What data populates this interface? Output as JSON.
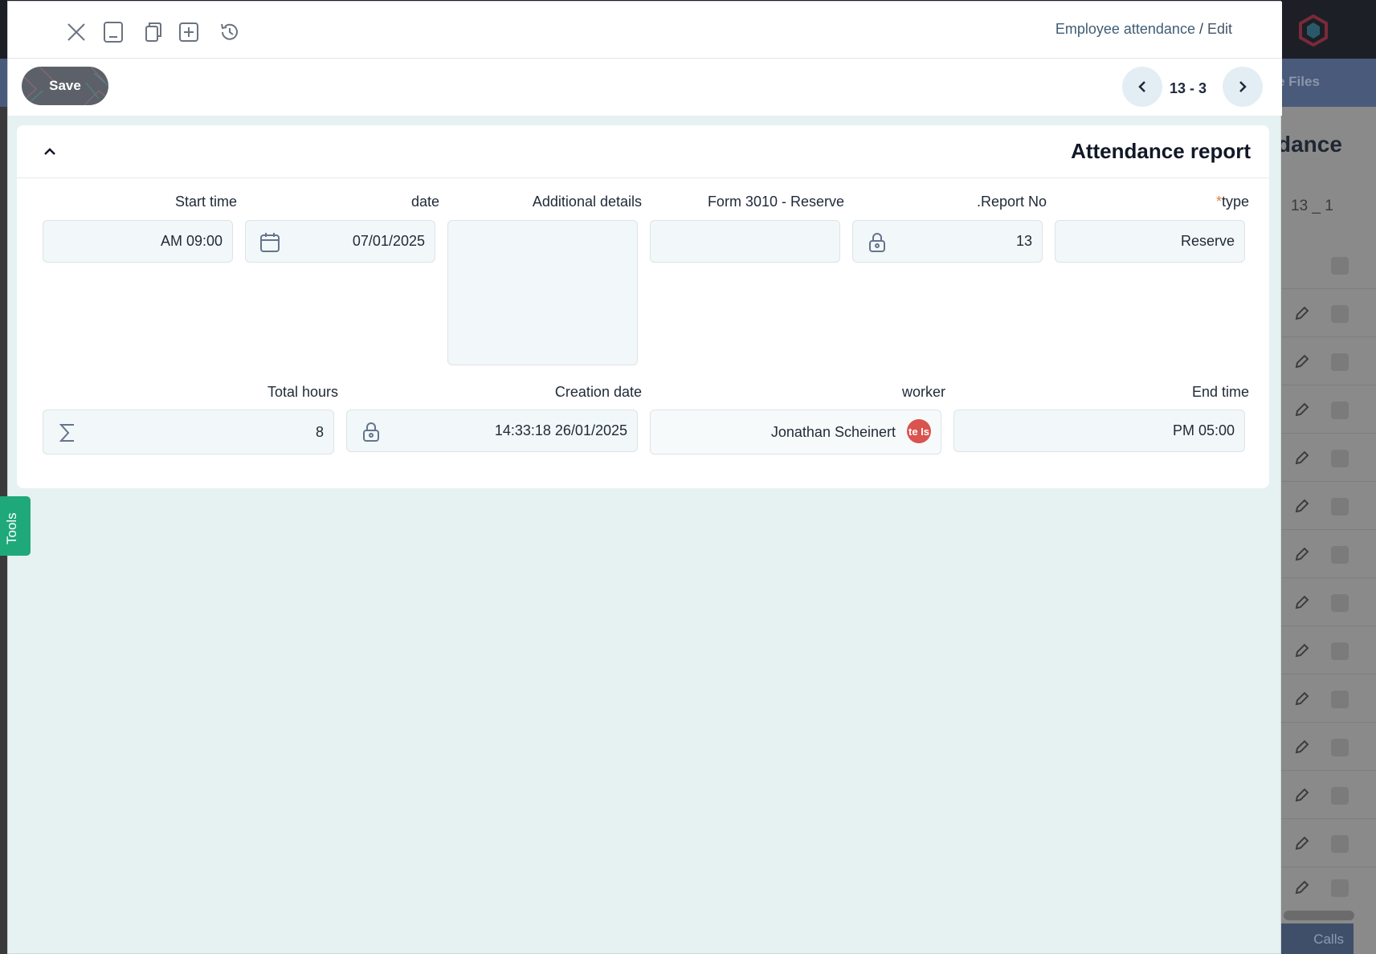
{
  "header": {
    "breadcrumb_main": "Employee attendance",
    "breadcrumb_sep": " / ",
    "breadcrumb_mode": "Edit",
    "icons": [
      "close-icon",
      "minimize-icon",
      "copy-icon",
      "add-icon",
      "history-icon"
    ]
  },
  "toolbar": {
    "save_label": "Save",
    "pager_text": "13 - 3"
  },
  "card": {
    "title": "Attendance report"
  },
  "fields": {
    "start_time": {
      "label": "Start time",
      "value": "AM 09:00"
    },
    "date": {
      "label": "date",
      "value": "07/01/2025"
    },
    "additional_details": {
      "label": "Additional details",
      "value": ""
    },
    "form_3010": {
      "label": "Form 3010 - Reserve",
      "value": ""
    },
    "report_no": {
      "label": ".Report No",
      "value": "13"
    },
    "type": {
      "label": "type",
      "required_mark": "*",
      "value": "Reserve"
    },
    "total_hours": {
      "label": "Total hours",
      "value": "8"
    },
    "creation_date": {
      "label": "Creation date",
      "value": "14:33:18 26/01/2025"
    },
    "worker": {
      "label": "worker",
      "value": "Jonathan Scheinert",
      "badge": "te Is"
    },
    "end_time": {
      "label": "End time",
      "value": "PM 05:00"
    }
  },
  "tools_tab": {
    "label": "Tools"
  },
  "background": {
    "nav_text": "e Files",
    "title": "dance",
    "count": "13 _ 1",
    "calls": "Calls"
  },
  "colors": {
    "accent_green": "#1fa97a",
    "save_button": "#5c6169",
    "required_mark": "#e0803c",
    "badge_red": "#d9534f"
  }
}
